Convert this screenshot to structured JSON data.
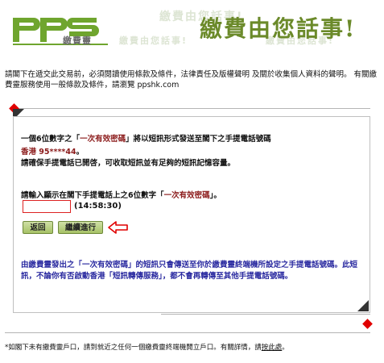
{
  "header": {
    "logo_text": "PPS",
    "logo_sub": "繳費靈",
    "slogan": "繳費由您話事!",
    "slogan_faint_top": "繳費由您話事!",
    "slogan_faint_left": "繳費由您話事!",
    "slogan_faint_right": "繳費由您話事!",
    "brand_color": "#6b8a2a"
  },
  "intro": {
    "text": "請閣下在遞交此交易前，必須閱讀使用條款及條件，法律責任及版權聲明 及關於收集個人資料的聲明。 有關繳費靈服務使用一般條款及條件，請瀏覽 ppshk.com"
  },
  "panel": {
    "line1_prefix": "一個6位數字之「",
    "line1_highlight": "一次有效密碼",
    "line1_suffix": "」將以短訊形式發送至閣下之手提電話號碼",
    "phone": "香港 95****44",
    "phone_suffix": "。",
    "line2": "請確保手提電話已開啓，可收取短訊並有足夠的短訊記憶容量。",
    "prompt_prefix": "請輸入顯示在閣下手提電話上之6位數字「",
    "prompt_highlight": "一次有效密碼",
    "prompt_suffix": "」。",
    "otp_value": "",
    "otp_placeholder": "",
    "timer": "(14:58:30)",
    "back_label": "返回",
    "continue_label": "繼續進行",
    "notice": "由繳費靈發出之「一次有效密碼」的短訊只會傳送至你於繳費靈終端機所設定之手提電話號碼。此短訊，不論你有否啟動香港「短訊轉傳服務」，都不會再轉傳至其他手提電話號碼。"
  },
  "footer": {
    "note_prefix": "*如閣下未有繳費靈戶口，請到就近之任何一個繳費靈終端機開立戶口。有關詳情，請",
    "note_link": "按此處",
    "note_suffix": "。"
  },
  "colors": {
    "accent_red": "#e00000",
    "maroon": "#8b1a1a",
    "notice_blue": "#2a2aa0",
    "button_green": "#a6c166"
  }
}
